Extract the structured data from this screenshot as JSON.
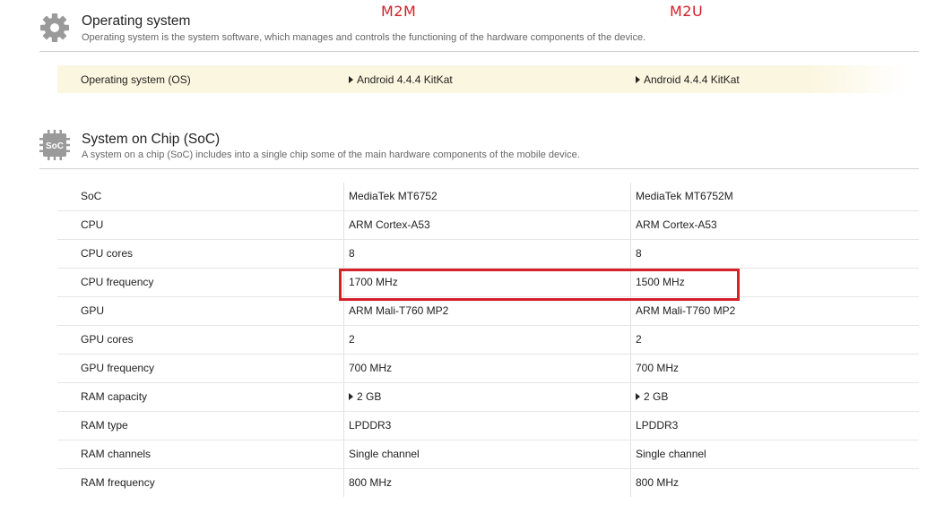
{
  "annotations": {
    "m2m_label": "M2M",
    "m2u_label": "M2U"
  },
  "os_section": {
    "icon": "gear-icon",
    "title": "Operating system",
    "description": "Operating system is the system software, which manages and controls the functioning of the hardware components of the device.",
    "row": {
      "label": "Operating system (OS)",
      "m2m": "Android 4.4.4 KitKat",
      "m2u": "Android 4.4.4 KitKat"
    }
  },
  "soc_section": {
    "icon": "soc-chip-icon",
    "icon_text": "SoC",
    "title": "System on Chip (SoC)",
    "description": "A system on a chip (SoC) includes into a single chip some of the main hardware components of the mobile device.",
    "rows": [
      {
        "label": "SoC",
        "m2m": "MediaTek MT6752",
        "m2u": "MediaTek MT6752M",
        "expandable": false
      },
      {
        "label": "CPU",
        "m2m": "ARM Cortex-A53",
        "m2u": "ARM Cortex-A53",
        "expandable": false
      },
      {
        "label": "CPU cores",
        "m2m": "8",
        "m2u": "8",
        "expandable": false
      },
      {
        "label": "CPU frequency",
        "m2m": "1700 MHz",
        "m2u": "1500 MHz",
        "expandable": false
      },
      {
        "label": "GPU",
        "m2m": "ARM Mali-T760 MP2",
        "m2u": "ARM Mali-T760 MP2",
        "expandable": false
      },
      {
        "label": "GPU cores",
        "m2m": "2",
        "m2u": "2",
        "expandable": false
      },
      {
        "label": "GPU frequency",
        "m2m": "700 MHz",
        "m2u": "700 MHz",
        "expandable": false
      },
      {
        "label": "RAM capacity",
        "m2m": "2 GB",
        "m2u": "2 GB",
        "expandable": true
      },
      {
        "label": "RAM type",
        "m2m": "LPDDR3",
        "m2u": "LPDDR3",
        "expandable": false
      },
      {
        "label": "RAM channels",
        "m2m": "Single channel",
        "m2u": "Single channel",
        "expandable": false
      },
      {
        "label": "RAM frequency",
        "m2m": "800 MHz",
        "m2u": "800 MHz",
        "expandable": false
      }
    ]
  },
  "colors": {
    "annotation_red": "#d6202a",
    "highlight_row": "#fbf6df",
    "icon_gray": "#9a9a9a"
  }
}
